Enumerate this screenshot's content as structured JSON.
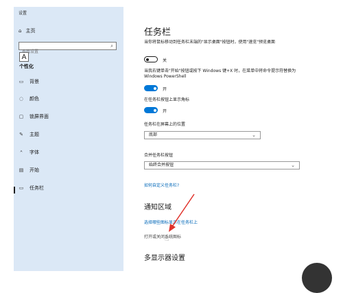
{
  "sidebar": {
    "window_title": "设置",
    "home_label": "主页",
    "search": {
      "placeholder": "查找设置"
    },
    "tooltip_char": "A",
    "section_label": "个性化",
    "items": [
      {
        "label": "背景",
        "icon": "image-icon"
      },
      {
        "label": "颜色",
        "icon": "palette-icon"
      },
      {
        "label": "锁屏界面",
        "icon": "lock-screen-icon"
      },
      {
        "label": "主题",
        "icon": "brush-icon"
      },
      {
        "label": "字体",
        "icon": "font-icon"
      },
      {
        "label": "开始",
        "icon": "start-icon"
      },
      {
        "label": "任务栏",
        "icon": "taskbar-icon"
      }
    ]
  },
  "main": {
    "title": "任务栏",
    "desc1": "当你将鼠标移动到任务栏末端的\"显示桌面\"按钮时，使用\"速览\"预览桌面",
    "toggle1_label": "关",
    "desc2": "当我右键单击\"开始\"按钮或按下 Windows 键+X 时，在菜单中将命令提示符替换为 Windows PowerShell",
    "toggle2_label": "开",
    "desc3": "在任务栏按钮上显示角标",
    "toggle3_label": "开",
    "position_label": "任务栏在屏幕上的位置",
    "position_value": "底部",
    "combine_label": "合并任务栏按钮",
    "combine_value": "始终合并按钮",
    "customize_link": "如何自定义任务栏?",
    "notify_heading": "通知区域",
    "notify_link": "选择哪些图标显示在任务栏上",
    "system_icons_text": "打开或关闭系统图标",
    "multi_heading": "多显示器设置"
  },
  "colors": {
    "sidebar_bg": "#dbe8f6",
    "accent": "#0078d7",
    "link": "#0067b8",
    "arrow": "#e0322b"
  }
}
